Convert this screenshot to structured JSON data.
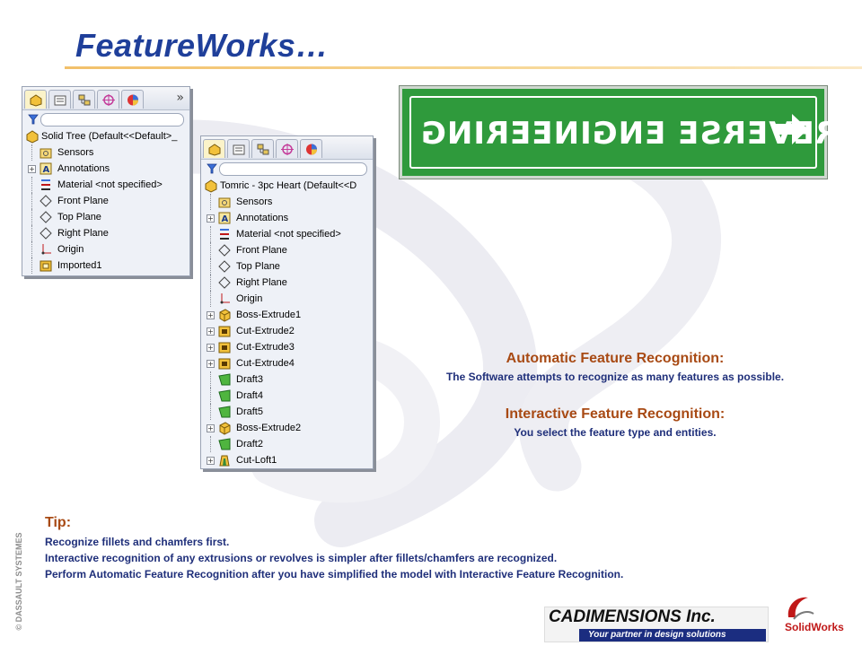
{
  "slide": {
    "title": "FeatureWorks…"
  },
  "tree_left": {
    "root_label": "Solid Tree  (Default<<Default>_",
    "more_chevron": "»",
    "items": [
      {
        "label": "Sensors",
        "icon": "sensors-folder-icon",
        "expandable": false
      },
      {
        "label": "Annotations",
        "icon": "annotations-icon",
        "expandable": true
      },
      {
        "label": "Material <not specified>",
        "icon": "material-icon",
        "expandable": false
      },
      {
        "label": "Front Plane",
        "icon": "plane-icon",
        "expandable": false
      },
      {
        "label": "Top Plane",
        "icon": "plane-icon",
        "expandable": false
      },
      {
        "label": "Right Plane",
        "icon": "plane-icon",
        "expandable": false
      },
      {
        "label": "Origin",
        "icon": "origin-icon",
        "expandable": false
      },
      {
        "label": "Imported1",
        "icon": "imported-body-icon",
        "expandable": false
      }
    ]
  },
  "tree_right": {
    "root_label": "Tomric - 3pc Heart  (Default<<D",
    "items": [
      {
        "label": "Sensors",
        "icon": "sensors-folder-icon",
        "expandable": false
      },
      {
        "label": "Annotations",
        "icon": "annotations-icon",
        "expandable": true
      },
      {
        "label": "Material <not specified>",
        "icon": "material-icon",
        "expandable": false
      },
      {
        "label": "Front Plane",
        "icon": "plane-icon",
        "expandable": false
      },
      {
        "label": "Top Plane",
        "icon": "plane-icon",
        "expandable": false
      },
      {
        "label": "Right Plane",
        "icon": "plane-icon",
        "expandable": false
      },
      {
        "label": "Origin",
        "icon": "origin-icon",
        "expandable": false
      },
      {
        "label": "Boss-Extrude1",
        "icon": "extrude-icon",
        "expandable": true
      },
      {
        "label": "Cut-Extrude2",
        "icon": "cut-extrude-icon",
        "expandable": true
      },
      {
        "label": "Cut-Extrude3",
        "icon": "cut-extrude-icon",
        "expandable": true
      },
      {
        "label": "Cut-Extrude4",
        "icon": "cut-extrude-icon",
        "expandable": true
      },
      {
        "label": "Draft3",
        "icon": "draft-icon",
        "expandable": false
      },
      {
        "label": "Draft4",
        "icon": "draft-icon",
        "expandable": false
      },
      {
        "label": "Draft5",
        "icon": "draft-icon",
        "expandable": false
      },
      {
        "label": "Boss-Extrude2",
        "icon": "extrude-icon",
        "expandable": true
      },
      {
        "label": "Draft2",
        "icon": "draft-icon",
        "expandable": false
      },
      {
        "label": "Cut-Loft1",
        "icon": "loft-icon",
        "expandable": true
      }
    ]
  },
  "sign": {
    "text": "REVERSE ENGINEERING",
    "arrow_icon": "right-arrow-icon",
    "bg_color": "#2f9a3c"
  },
  "automatic": {
    "heading": "Automatic Feature Recognition:",
    "desc": "The Software attempts to recognize as many features as possible."
  },
  "interactive": {
    "heading": "Interactive Feature Recognition:",
    "desc": "You select the feature type and entities."
  },
  "tip": {
    "heading": "Tip:",
    "lines": [
      "Recognize fillets and chamfers first.",
      "Interactive recognition of any extrusions or revolves is simpler after fillets/chamfers are recognized.",
      "Perform Automatic Feature Recognition after you have simplified the model with Interactive Feature Recognition."
    ]
  },
  "footer": {
    "dassault": "© DASSAULT SYSTEMES",
    "cad_name": "CADIMENSIONS Inc.",
    "cad_tagline": "Your partner in design solutions",
    "solidworks": "SolidWorks"
  },
  "colors": {
    "title": "#1f3f9a",
    "heading": "#a84a14",
    "body": "#1f2f7a"
  }
}
